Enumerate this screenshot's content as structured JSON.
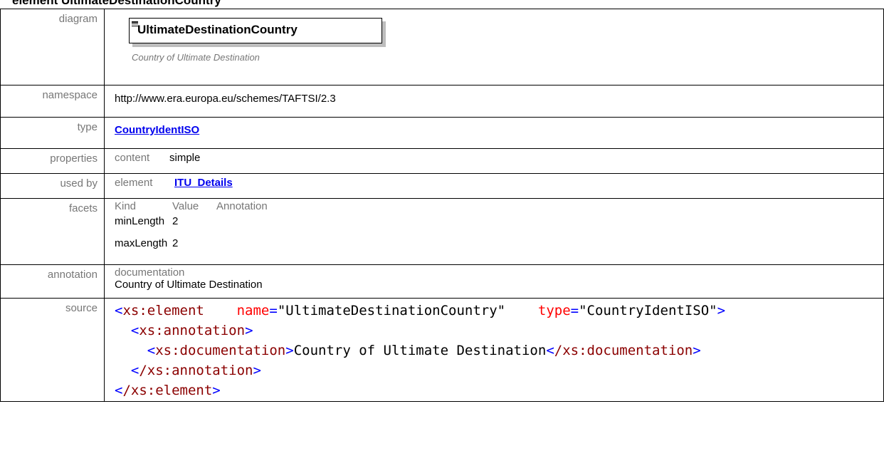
{
  "page_heading": "element UltimateDestinationCountry",
  "rows": {
    "diagram": {
      "label": "diagram",
      "element_name": "UltimateDestinationCountry",
      "element_doc": "Country of Ultimate Destination"
    },
    "namespace": {
      "label": "namespace",
      "value": "http://www.era.europa.eu/schemes/TAFTSI/2.3"
    },
    "type": {
      "label": "type",
      "value": "CountryIdentISO"
    },
    "properties": {
      "label": "properties",
      "key": "content",
      "value": "simple"
    },
    "used_by": {
      "label": "used by",
      "key": "element",
      "value": "ITU_Details"
    },
    "facets": {
      "label": "facets",
      "headers": [
        "Kind",
        "Value",
        "Annotation"
      ],
      "items": [
        {
          "kind": "minLength",
          "value": "2"
        },
        {
          "kind": "maxLength",
          "value": "2"
        }
      ]
    },
    "annotation": {
      "label": "annotation",
      "key": "documentation",
      "value": "Country of Ultimate Destination"
    },
    "source": {
      "label": "source",
      "element_open": "xs:element",
      "attr_name": "name",
      "attr_name_value": "\"UltimateDestinationCountry\"",
      "attr_type": "type",
      "attr_type_value": "\"CountryIdentISO\"",
      "annotation_tag": "xs:annotation",
      "documentation_tag": "xs:documentation",
      "documentation_text": "Country of Ultimate Destination",
      "annotation_close": "/xs:annotation",
      "element_close": "/xs:element"
    }
  },
  "colors": {
    "label_gray": "#777777",
    "link_blue": "#0000ee",
    "xml_tag": "#8b0000",
    "xml_bracket": "#0000ff",
    "xml_attr": "#ff0000"
  }
}
